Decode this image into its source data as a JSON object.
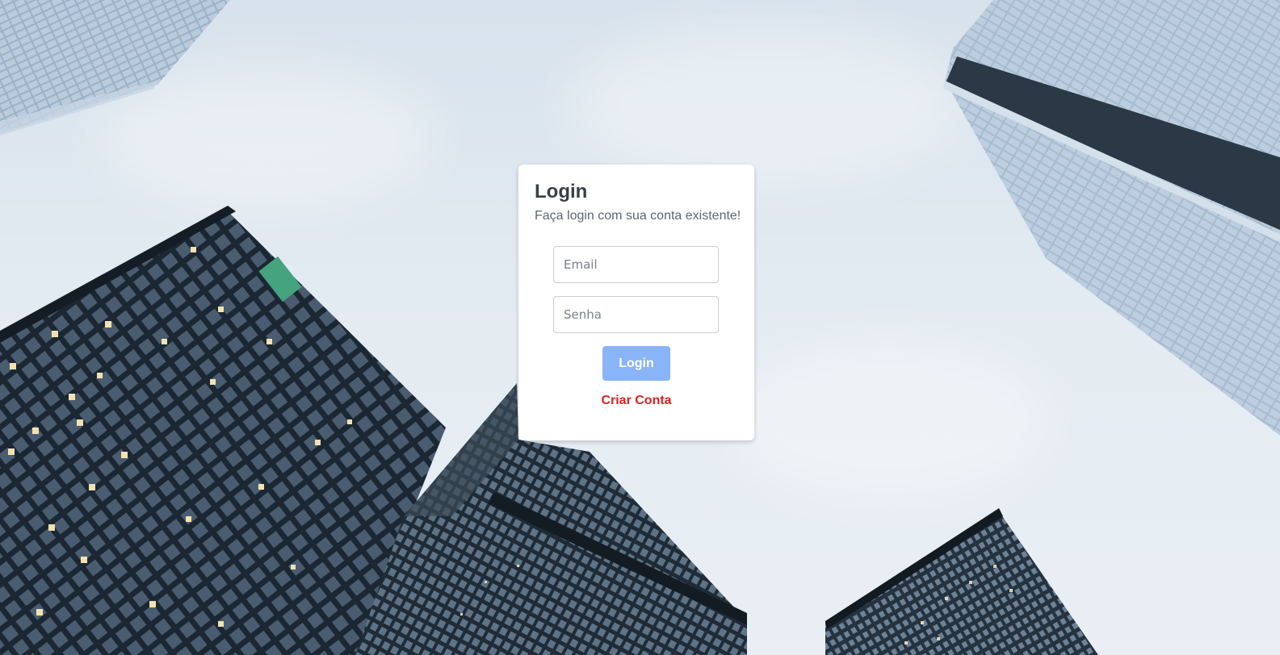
{
  "login_form": {
    "title": "Login",
    "subtitle": "Faça login com sua conta existente!",
    "email_placeholder": "Email",
    "password_placeholder": "Senha",
    "submit_label": "Login",
    "create_account_label": "Criar Conta"
  },
  "colors": {
    "button_bg": "#8ab4f8",
    "link_color": "#d9231d",
    "card_bg": "#ffffff"
  }
}
